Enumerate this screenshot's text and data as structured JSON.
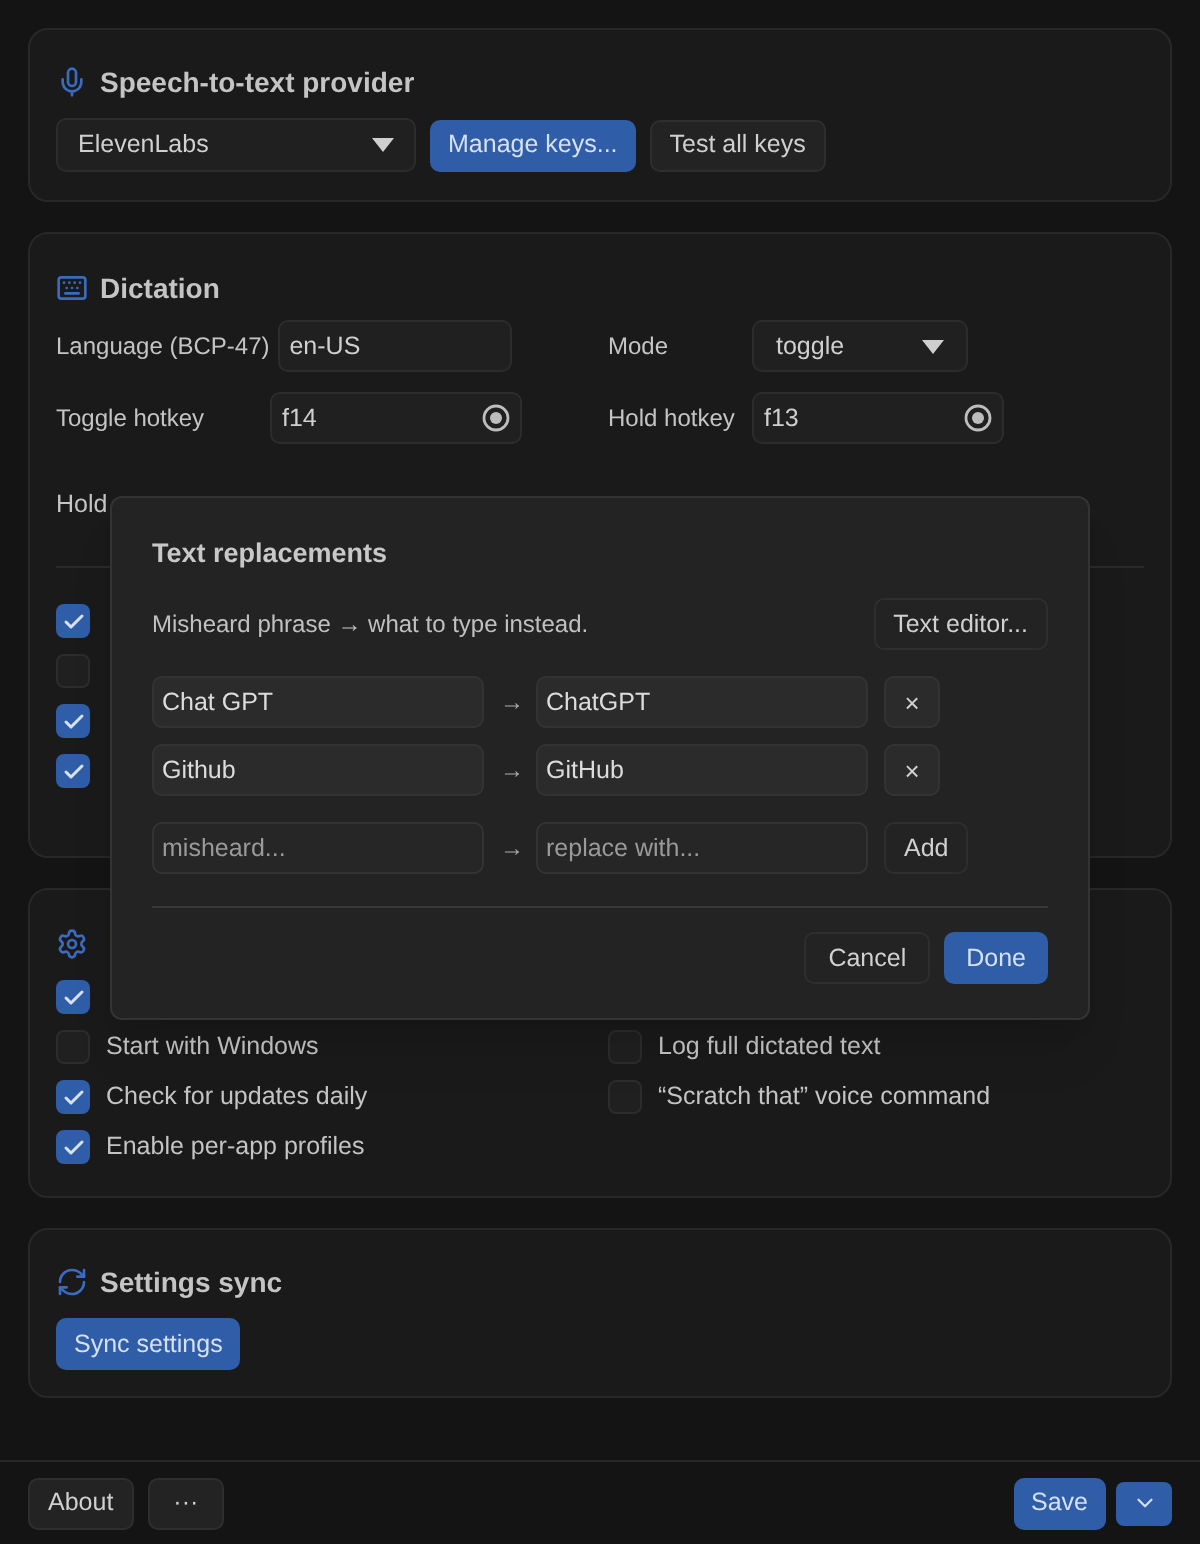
{
  "provider": {
    "title": "Speech-to-text provider",
    "select": "ElevenLabs",
    "buttons": [
      {
        "label": "Manage keys...",
        "primary": true
      },
      {
        "label": "Test all keys",
        "primary": false
      }
    ]
  },
  "dictation": {
    "title": "Dictation",
    "fields": [
      {
        "label": "Language (BCP-47)",
        "value": "en-US",
        "kind": "text"
      },
      {
        "label": "Mode",
        "value": "toggle",
        "kind": "select"
      },
      {
        "label": "Toggle hotkey",
        "value": "f14",
        "kind": "hotkey"
      },
      {
        "label": "Hold hotkey",
        "value": "f13",
        "kind": "hotkey"
      }
    ],
    "covered_label": "Hold",
    "checkboxes": [
      {
        "checked": true
      },
      {
        "checked": false
      },
      {
        "checked": true
      },
      {
        "checked": true
      }
    ]
  },
  "application": {
    "rows": [
      {
        "left": {
          "checked": true
        }
      },
      {
        "left": {
          "label": "Start with Windows",
          "checked": false
        },
        "right": {
          "label": "Log full dictated text",
          "checked": false
        }
      },
      {
        "left": {
          "label": "Check for updates daily",
          "checked": true
        },
        "right": {
          "label": "“Scratch that” voice command",
          "checked": false
        }
      },
      {
        "left": {
          "label": "Enable per-app profiles",
          "checked": true
        }
      }
    ]
  },
  "sync": {
    "title": "Settings sync",
    "button": "Sync settings"
  },
  "dialog": {
    "title": "Text replacements",
    "hint": "Misheard phrase → what to type instead.",
    "editor_button": "Text editor...",
    "rows": [
      {
        "from": "Chat GPT",
        "arrow": "→",
        "to": "ChatGPT",
        "remove": "×"
      },
      {
        "from": "Github",
        "arrow": "→",
        "to": "GitHub",
        "remove": "×"
      }
    ],
    "new_row": {
      "from_placeholder": "misheard...",
      "arrow": "→",
      "to_placeholder": "replace with...",
      "add": "Add"
    },
    "buttons": [
      {
        "label": "Cancel",
        "primary": false
      },
      {
        "label": "Done",
        "primary": true
      }
    ]
  },
  "footer": {
    "about": "About",
    "more": "···",
    "save": "Save"
  }
}
